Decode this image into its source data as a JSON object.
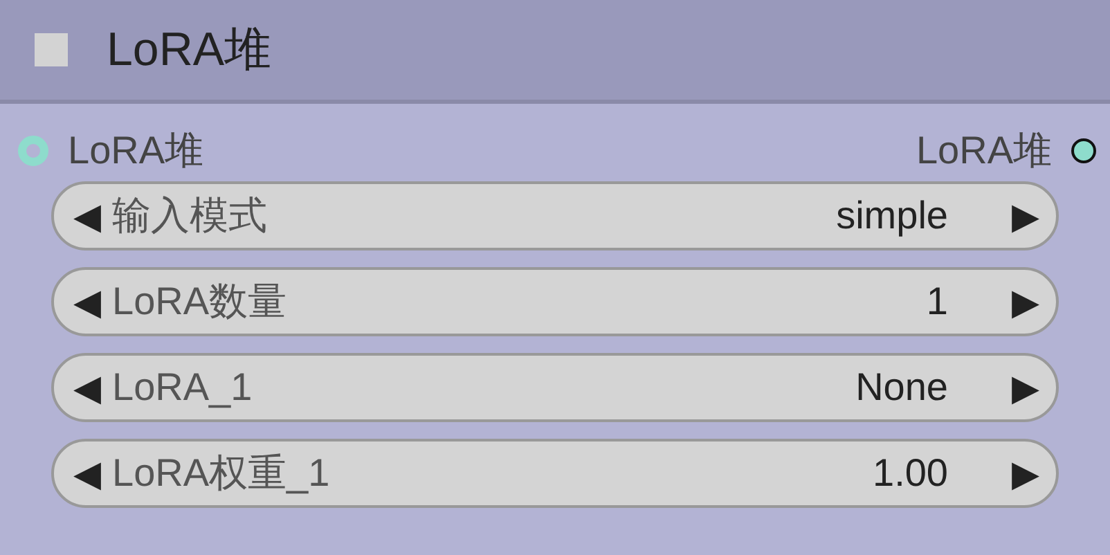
{
  "node": {
    "title": "LoRA堆",
    "collapsed": false
  },
  "input": {
    "label": "LoRA堆",
    "connected": false
  },
  "output": {
    "label": "LoRA堆",
    "connected": true
  },
  "widgets": [
    {
      "decrement": "◀",
      "label": "输入模式",
      "value": "simple",
      "increment": "▶"
    },
    {
      "decrement": "◀",
      "label": "LoRA数量",
      "value": "1",
      "increment": "▶"
    },
    {
      "decrement": "◀",
      "label": "LoRA_1",
      "value": "None",
      "increment": "▶"
    },
    {
      "decrement": "◀",
      "label": "LoRA权重_1",
      "value": "1.00",
      "increment": "▶"
    }
  ]
}
